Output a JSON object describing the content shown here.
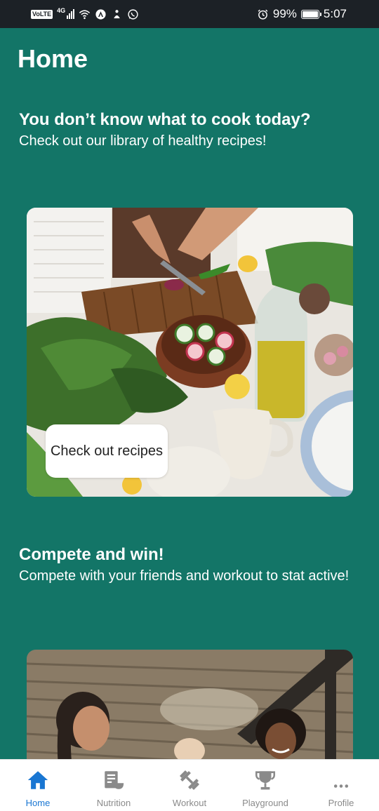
{
  "status_bar": {
    "volte": "VoLTE",
    "network": "4G",
    "battery_percent": "99%",
    "time": "5:07",
    "battery_level": 0.99
  },
  "page": {
    "title": "Home"
  },
  "sections": [
    {
      "title": "You don’t know what to cook today?",
      "subtitle": "Check out our library of healthy recipes!",
      "button_label": "Check out recipes",
      "image_icon": "cooking-photo"
    },
    {
      "title": "Compete and win!",
      "subtitle": "Compete with your friends and workout to stat active!",
      "image_icon": "friends-photo"
    }
  ],
  "nav": {
    "active_color": "#1976d2",
    "inactive_color": "#8a8a8a",
    "items": [
      {
        "label": "Home",
        "icon": "home-icon"
      },
      {
        "label": "Nutrition",
        "icon": "nutrition-icon"
      },
      {
        "label": "Workout",
        "icon": "dumbbell-icon"
      },
      {
        "label": "Playground",
        "icon": "trophy-icon"
      },
      {
        "label": "Profile",
        "icon": "more-icon"
      }
    ]
  },
  "colors": {
    "background": "#137567",
    "status_bar": "#1c2126"
  }
}
